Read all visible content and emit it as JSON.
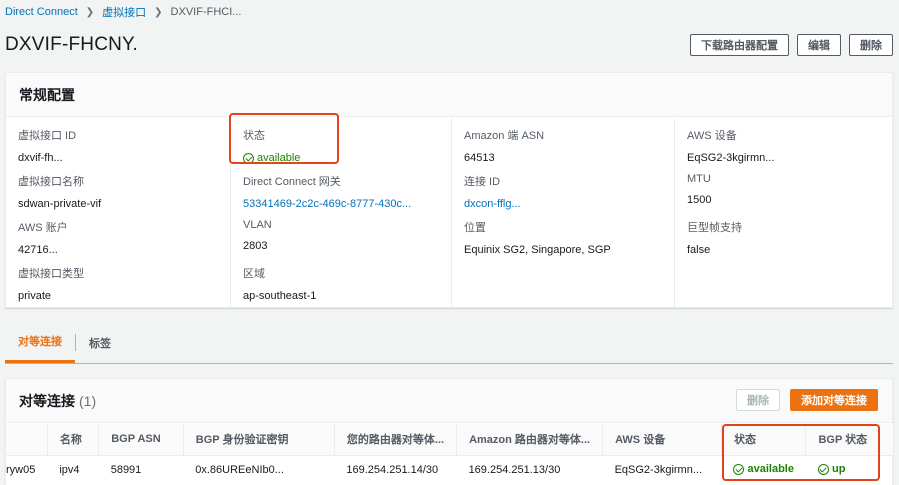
{
  "breadcrumb": {
    "item1": "Direct Connect",
    "item2": "虚拟接口",
    "item3": "DXVIF-FHCI..."
  },
  "page": {
    "title": "DXVIF-FHCNY.",
    "actions": {
      "download": "下载路由器配置",
      "edit": "编辑",
      "delete": "删除"
    }
  },
  "general": {
    "title": "常规配置",
    "vif_id": {
      "label": "虚拟接口 ID",
      "value": "dxvif-fh..."
    },
    "vif_name": {
      "label": "虚拟接口名称",
      "value": "sdwan-private-vif"
    },
    "account": {
      "label": "AWS 账户",
      "value": "42716..."
    },
    "vif_type": {
      "label": "虚拟接口类型",
      "value": "private"
    },
    "state": {
      "label": "状态",
      "value": "available"
    },
    "dx_gateway": {
      "label": "Direct Connect 网关",
      "value": "53341469-2c2c-469c-8777-430c..."
    },
    "vlan": {
      "label": "VLAN",
      "value": "2803"
    },
    "region": {
      "label": "区域",
      "value": "ap-southeast-1"
    },
    "amazon_asn": {
      "label": "Amazon 端 ASN",
      "value": "64513"
    },
    "connection_id": {
      "label": "连接 ID",
      "value": "dxcon-fflg..."
    },
    "location": {
      "label": "位置",
      "value": "Equinix SG2, Singapore, SGP"
    },
    "aws_device": {
      "label": "AWS 设备",
      "value": "EqSG2-3kgirmn..."
    },
    "mtu": {
      "label": "MTU",
      "value": "1500"
    },
    "jumbo": {
      "label": "巨型帧支持",
      "value": "false"
    }
  },
  "tabs": {
    "peering": "对等连接",
    "tags": "标签"
  },
  "peers": {
    "title": "对等连接",
    "count": "(1)",
    "delete": "删除",
    "add": "添加对等连接",
    "columns": [
      "",
      "名称",
      "BGP ASN",
      "BGP 身份验证密钥",
      "您的路由器对等体...",
      "Amazon 路由器对等体...",
      "AWS 设备",
      "状态",
      "BGP 状态"
    ],
    "row": {
      "id": "ryw05",
      "name": "ipv4",
      "asn": "58991",
      "auth": "0x.86UREeNIb0...",
      "your_peer": "169.254.251.14/30",
      "amazon_peer": "169.254.251.13/30",
      "device": "EqSG2-3kgirmn...",
      "state": "available",
      "bgp": "up"
    }
  },
  "colors": {
    "accent": "#ec7211",
    "link": "#0073bb",
    "success": "#1d8102",
    "annotation": "#e2431b"
  }
}
